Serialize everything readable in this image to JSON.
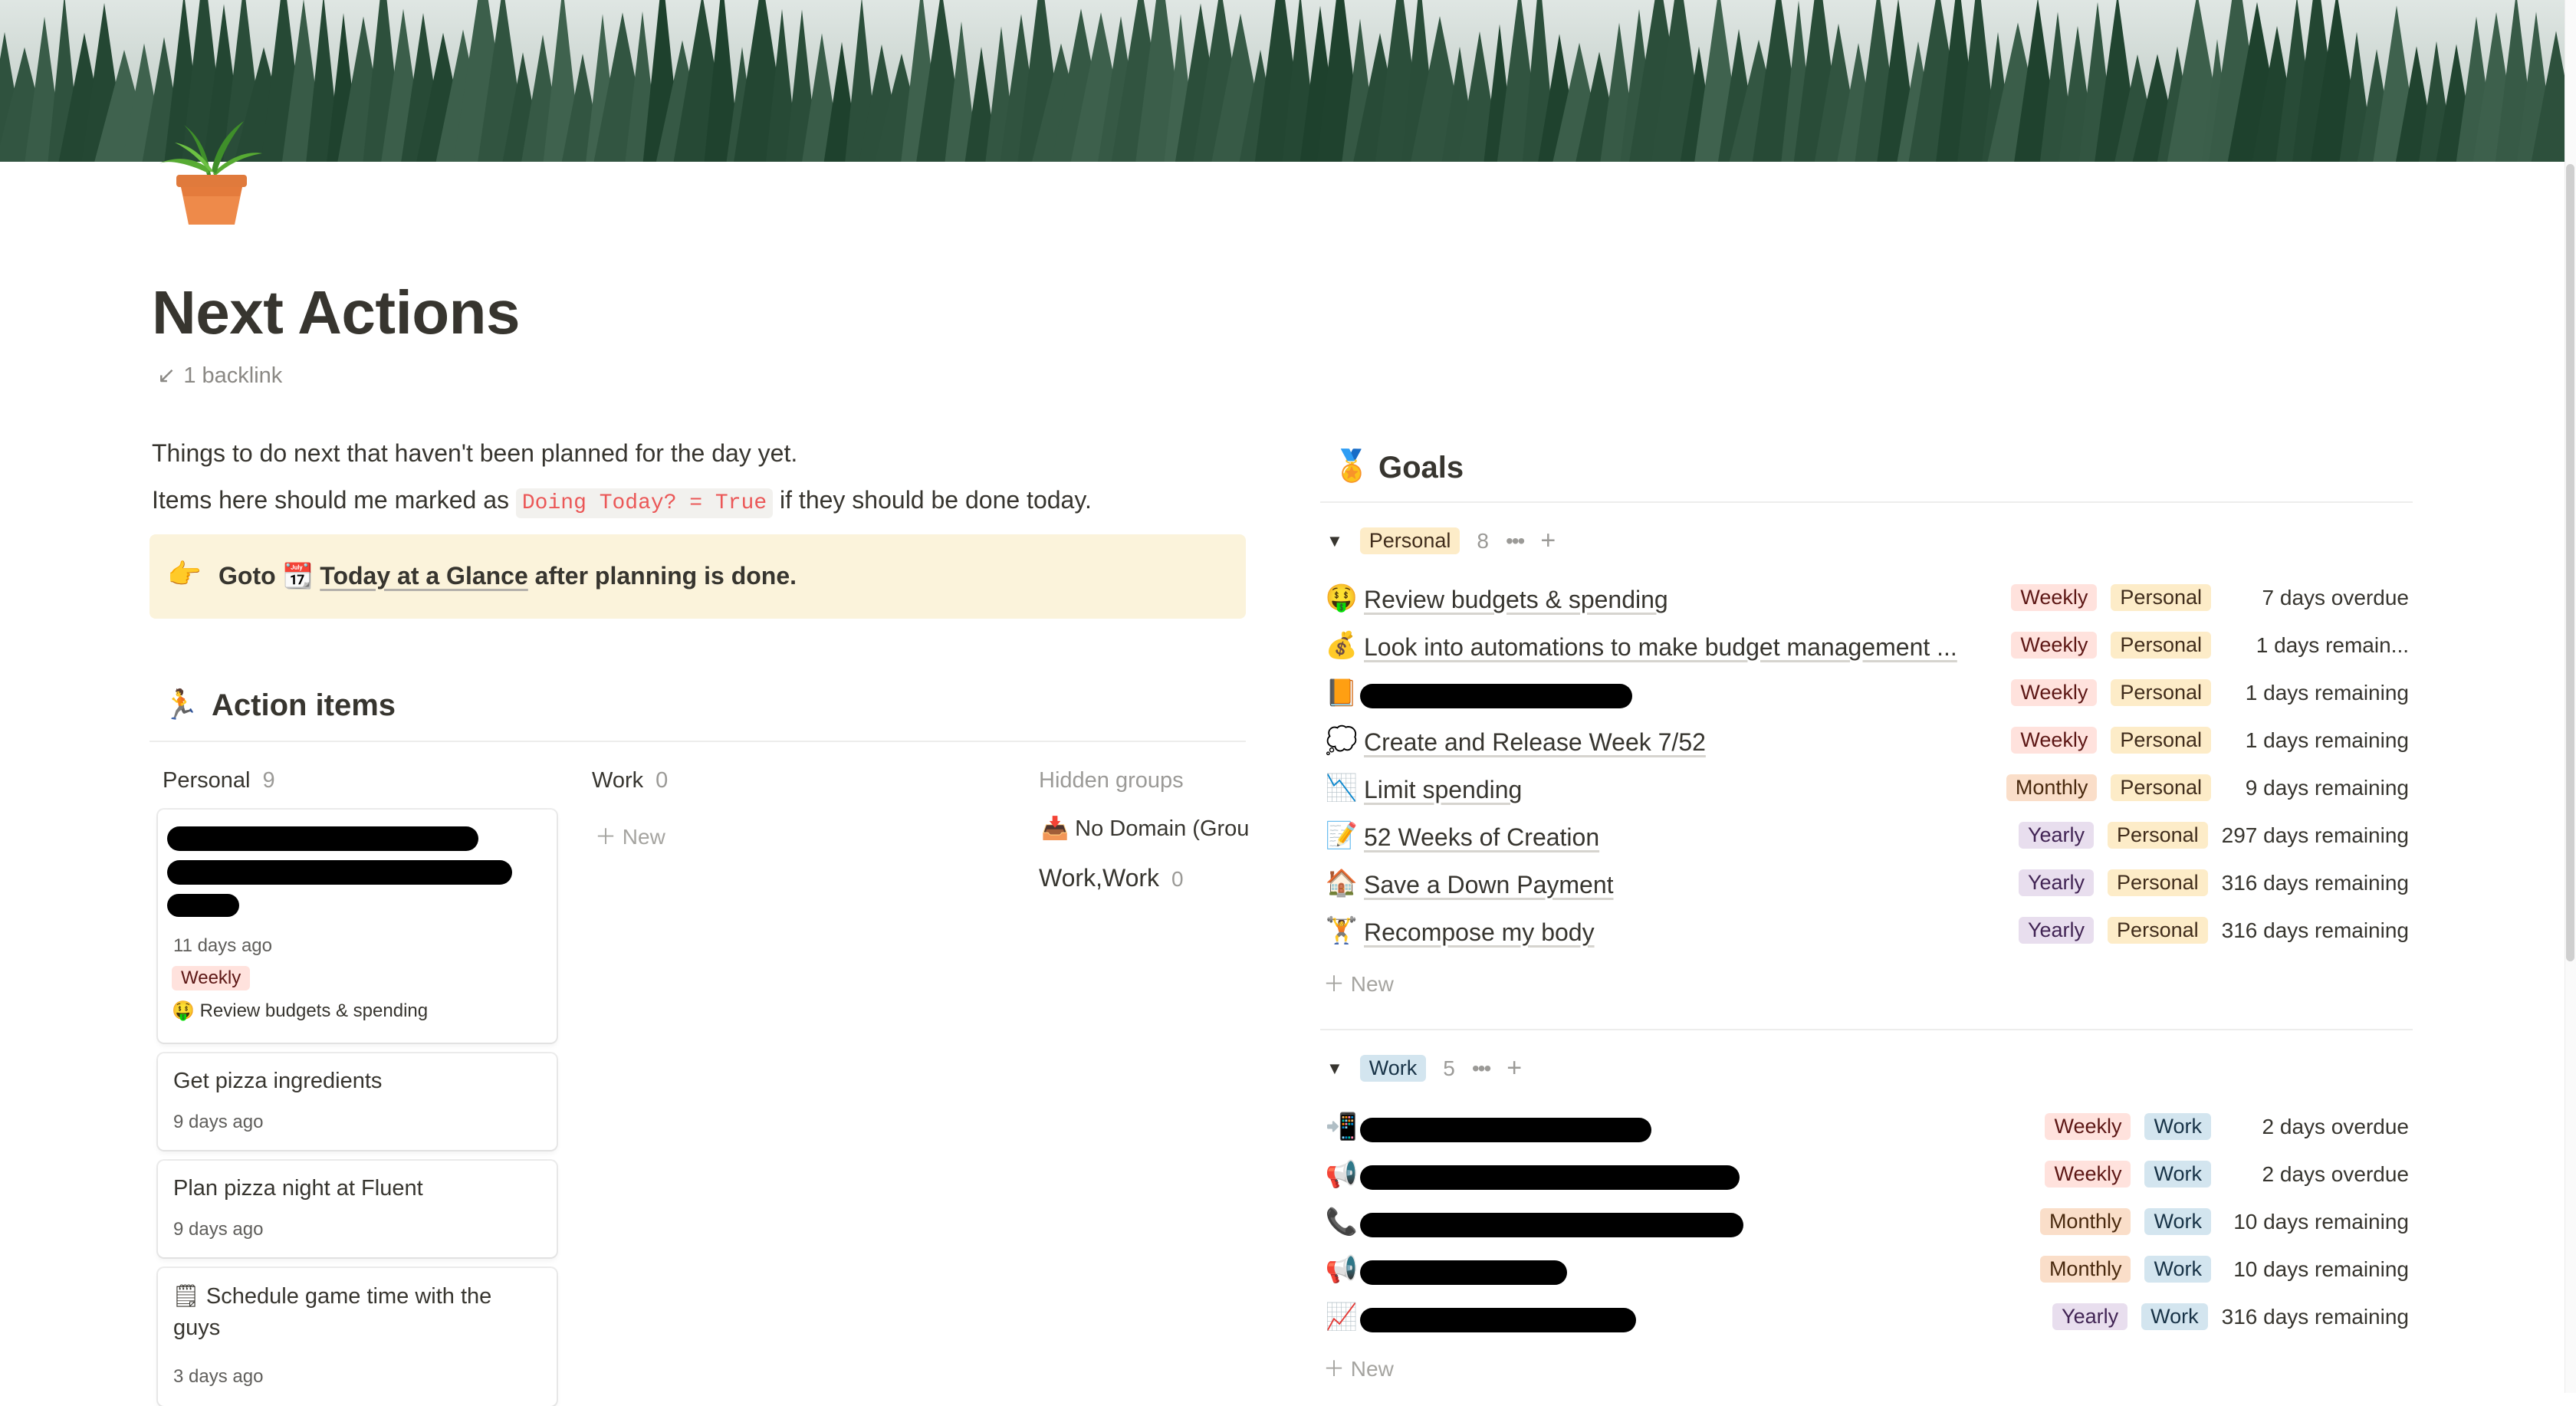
{
  "page": {
    "title": "Next Actions",
    "backlink": "1 backlink",
    "desc_line1": "Things to do next that haven't been planned for the day yet.",
    "desc_line2_pre": "Items here should me marked as",
    "desc_line2_code": "Doing Today? = True",
    "desc_line2_post": "if they should be done today.",
    "callout": {
      "pre": "Goto",
      "link": "Today at a Glance",
      "post": "after planning is done."
    }
  },
  "action_items": {
    "heading": "Action items",
    "columns": [
      {
        "label": "Personal",
        "count": "9"
      },
      {
        "label": "Work",
        "count": "0"
      }
    ],
    "new_label": "New",
    "hidden_groups": {
      "label": "Hidden groups",
      "items": [
        {
          "label": "No Domain (Grou"
        },
        {
          "label": "Work,Work",
          "count": "0"
        }
      ]
    },
    "cards": [
      {
        "title": "",
        "date": "11 days ago",
        "tag": "Weekly",
        "relation": "Review budgets & spending"
      },
      {
        "title": "Get pizza ingredients",
        "date": "9 days ago"
      },
      {
        "title": "Plan pizza night at Fluent",
        "date": "9 days ago"
      },
      {
        "title_line1": "Schedule game time with the",
        "title_line2": "guys",
        "date": "3 days ago"
      }
    ]
  },
  "goals": {
    "heading": "Goals",
    "new_label": "New",
    "groups": [
      {
        "label": "Personal",
        "count": "8",
        "rows": [
          {
            "name": "Review budgets & spending",
            "freq": "Weekly",
            "domain": "Personal",
            "due": "7 days overdue"
          },
          {
            "name": "Look into automations to make budget management ...",
            "freq": "Weekly",
            "domain": "Personal",
            "due": "1 days remain..."
          },
          {
            "name": "",
            "freq": "Weekly",
            "domain": "Personal",
            "due": "1 days remaining"
          },
          {
            "name": "Create and Release Week 7/52",
            "freq": "Weekly",
            "domain": "Personal",
            "due": "1 days remaining"
          },
          {
            "name": "Limit spending",
            "freq": "Monthly",
            "domain": "Personal",
            "due": "9 days remaining"
          },
          {
            "name": "52 Weeks of Creation",
            "freq": "Yearly",
            "domain": "Personal",
            "due": "297 days remaining"
          },
          {
            "name": "Save a Down Payment",
            "freq": "Yearly",
            "domain": "Personal",
            "due": "316 days remaining"
          },
          {
            "name": "Recompose my body",
            "freq": "Yearly",
            "domain": "Personal",
            "due": "316 days remaining"
          }
        ]
      },
      {
        "label": "Work",
        "count": "5",
        "rows": [
          {
            "name": "",
            "freq": "Weekly",
            "domain": "Work",
            "due": "2 days overdue"
          },
          {
            "name": "",
            "freq": "Weekly",
            "domain": "Work",
            "due": "2 days overdue"
          },
          {
            "name": "",
            "freq": "Monthly",
            "domain": "Work",
            "due": "10 days remaining"
          },
          {
            "name": "",
            "freq": "Monthly",
            "domain": "Work",
            "due": "10 days remaining"
          },
          {
            "name": "",
            "freq": "Yearly",
            "domain": "Work",
            "due": "316 days remaining"
          }
        ]
      }
    ]
  }
}
